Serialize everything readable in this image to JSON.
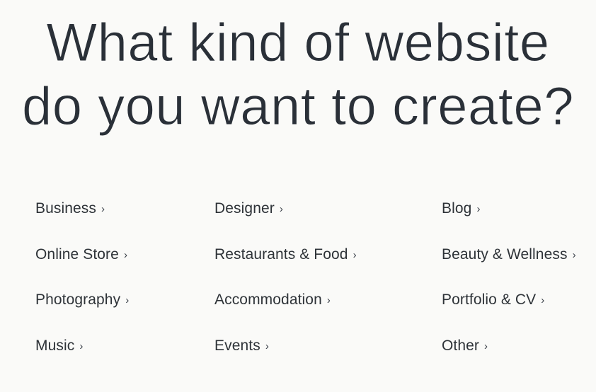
{
  "page": {
    "background_color": "#fafaf8",
    "heading_color": "#2a3038",
    "link_color": "#2e3338",
    "chevron_color": "#3a4048"
  },
  "heading": {
    "line1": "What kind of website",
    "line2": "do you want to create?"
  },
  "categories": {
    "chevron_glyph": "›",
    "columns": [
      {
        "column_name": "column-1",
        "items": [
          {
            "label": "Business"
          },
          {
            "label": "Online Store"
          },
          {
            "label": "Photography"
          },
          {
            "label": "Music"
          }
        ]
      },
      {
        "column_name": "column-2",
        "items": [
          {
            "label": "Designer"
          },
          {
            "label": "Restaurants & Food"
          },
          {
            "label": "Accommodation"
          },
          {
            "label": "Events"
          }
        ]
      },
      {
        "column_name": "column-3",
        "items": [
          {
            "label": "Blog"
          },
          {
            "label": "Beauty & Wellness"
          },
          {
            "label": "Portfolio & CV"
          },
          {
            "label": "Other"
          }
        ]
      }
    ]
  }
}
